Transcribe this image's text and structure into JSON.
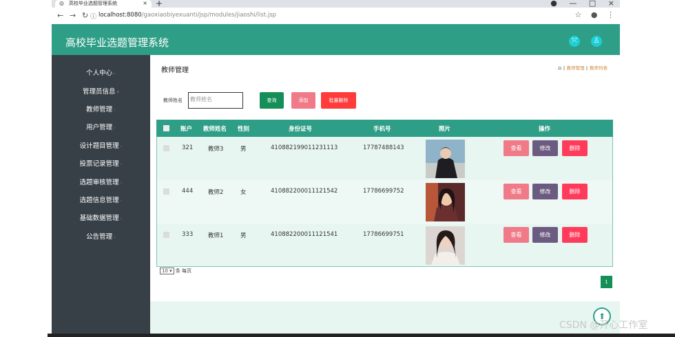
{
  "browser": {
    "tab_title": "高校毕业选题管理系统",
    "tab_close": "×",
    "new_tab": "+",
    "url_host": "localhost:8080",
    "url_path": "/gaoxiaobiyexuanti/jsp/modules/jiaoshi/list.jsp",
    "window_controls": [
      "—",
      "□",
      "×"
    ]
  },
  "header": {
    "title": "高校毕业选题管理系统"
  },
  "sidebar": {
    "items": [
      {
        "label": "个人中心"
      },
      {
        "label": "管理员信息"
      },
      {
        "label": "教师管理"
      },
      {
        "label": "用户管理"
      },
      {
        "label": "设计题目管理"
      },
      {
        "label": "投票记录管理"
      },
      {
        "label": "选题审核管理"
      },
      {
        "label": "选题信息管理"
      },
      {
        "label": "基础数据管理"
      },
      {
        "label": "公告管理"
      }
    ]
  },
  "main": {
    "title": "教师管理",
    "breadcrumb": {
      "sep": "‖",
      "parent": "教师管理",
      "current": "教师列表"
    },
    "search": {
      "label": "教师姓名",
      "placeholder": "教师姓名",
      "query_button": "查询",
      "add_button": "添加",
      "batch_delete_button": "批量删除"
    },
    "table": {
      "columns": [
        "账户",
        "教师姓名",
        "性别",
        "身份证号",
        "手机号",
        "照片",
        "操作"
      ],
      "rows": [
        {
          "account": "321",
          "name": "教师3",
          "gender": "男",
          "id_number": "410882199011231113",
          "phone": "17787488143"
        },
        {
          "account": "444",
          "name": "教师2",
          "gender": "女",
          "id_number": "410882200011121542",
          "phone": "17786699752"
        },
        {
          "account": "333",
          "name": "教师1",
          "gender": "男",
          "id_number": "410882200011121541",
          "phone": "17786699751"
        }
      ],
      "actions": {
        "view": "查看",
        "edit": "修改",
        "delete": "删除"
      }
    },
    "pager": {
      "page_size": "10",
      "per_page_label": "条 每页",
      "current_page": "1"
    }
  },
  "watermark": "CSDN @开心工作室",
  "colors": {
    "header": "#2f9e86",
    "sidebar": "#374047",
    "query": "#158f57",
    "add": "#f07a88",
    "batch_delete": "#ff3b3b",
    "edit": "#6b5b80"
  }
}
